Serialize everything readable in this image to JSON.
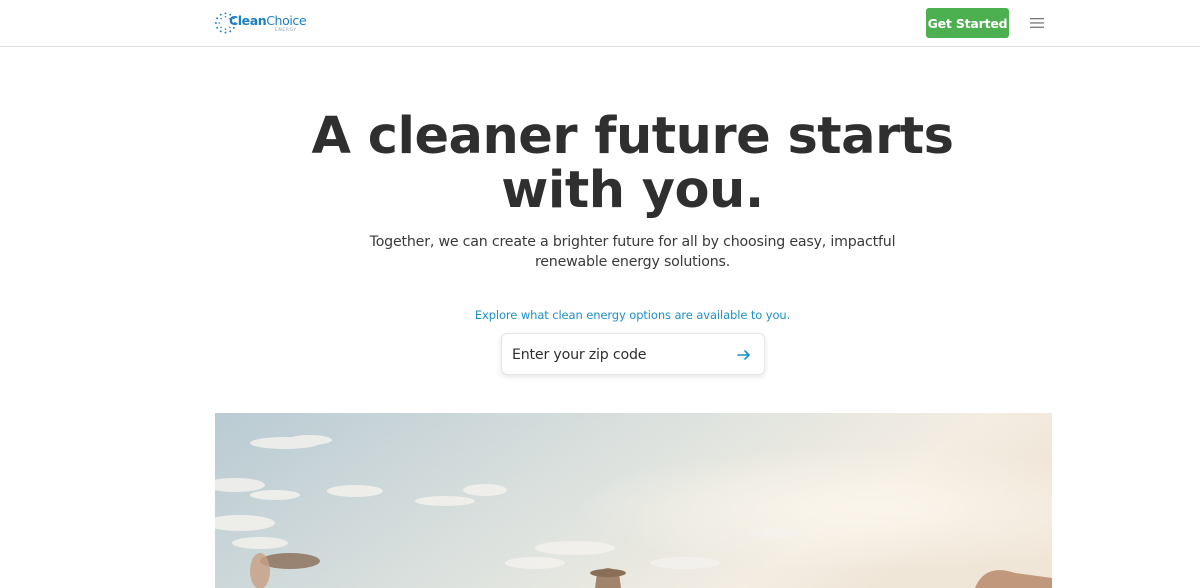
{
  "header": {
    "logo": {
      "word_part1": "Clean",
      "word_part2": "Choice",
      "sub": "ENERGY",
      "icon": "sunburst-logo-icon"
    },
    "cta_label": "Get Started",
    "menu_icon": "hamburger-menu-icon"
  },
  "hero": {
    "title": "A cleaner future starts with you.",
    "subtitle": "Together, we can create a brighter future for all by choosing easy, impactful renewable energy solutions."
  },
  "zip_search": {
    "prompt": "Explore what clean energy options are available to you.",
    "placeholder": "Enter your zip code",
    "submit_icon": "arrow-right-icon"
  },
  "colors": {
    "brand_blue": "#1b7fc4",
    "cta_green": "#4caf50",
    "link_blue": "#1d8fc9",
    "text_dark": "#2f2f2f"
  }
}
